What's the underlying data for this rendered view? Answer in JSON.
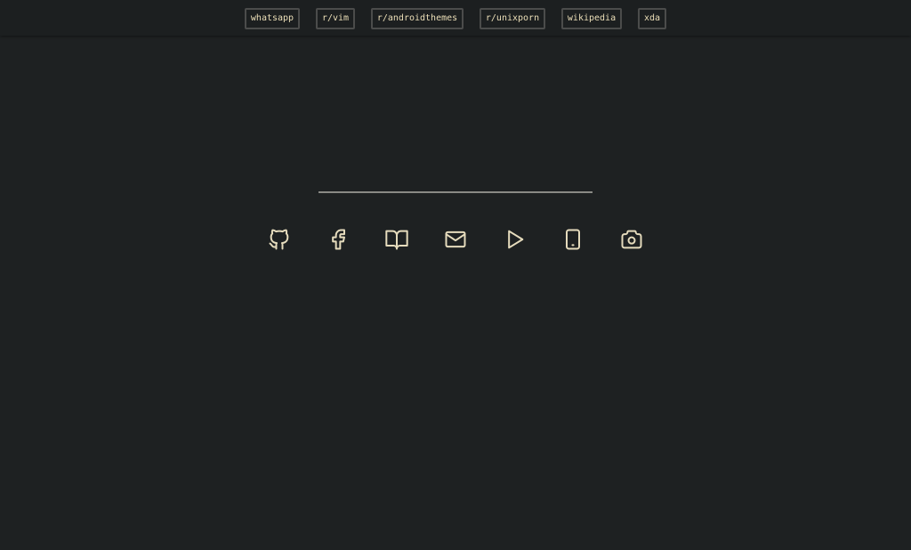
{
  "top_links": [
    {
      "label": "whatsapp"
    },
    {
      "label": "r/vim"
    },
    {
      "label": "r/androidthemes"
    },
    {
      "label": "r/unixporn"
    },
    {
      "label": "wikipedia"
    },
    {
      "label": "xda"
    }
  ],
  "icons": [
    {
      "name": "github-icon"
    },
    {
      "name": "facebook-icon"
    },
    {
      "name": "book-icon"
    },
    {
      "name": "mail-icon"
    },
    {
      "name": "play-icon"
    },
    {
      "name": "phone-icon"
    },
    {
      "name": "camera-icon"
    }
  ],
  "colors": {
    "background": "#1e2122",
    "topbar": "#1c1f20",
    "link_border": "#4b4c4b",
    "text": "#ecdfb8",
    "icon": "#e6dcbd",
    "divider": "#8a8a85"
  }
}
